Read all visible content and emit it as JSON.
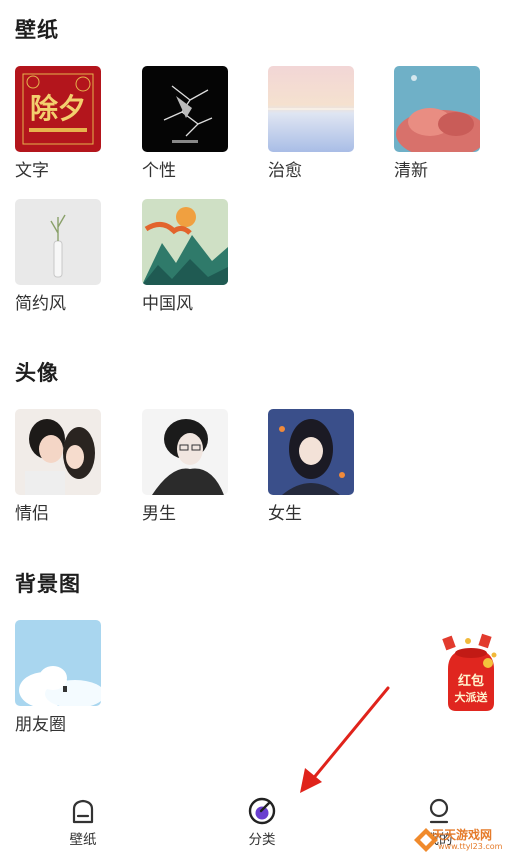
{
  "sections": {
    "wallpaper": {
      "title": "壁纸"
    },
    "avatar": {
      "title": "头像"
    },
    "background": {
      "title": "背景图"
    }
  },
  "wallpaper_items": [
    {
      "label": "文字",
      "thumb_text": "除夕"
    },
    {
      "label": "个性"
    },
    {
      "label": "治愈"
    },
    {
      "label": "清新"
    },
    {
      "label": "简约风"
    },
    {
      "label": "中国风"
    }
  ],
  "avatar_items": [
    {
      "label": "情侣"
    },
    {
      "label": "男生"
    },
    {
      "label": "女生"
    }
  ],
  "background_items": [
    {
      "label": "朋友圈"
    }
  ],
  "promo": {
    "line1": "红包",
    "line2": "大派送"
  },
  "tabbar": {
    "tabs": [
      {
        "label": "壁纸",
        "icon": "home-icon"
      },
      {
        "label": "分类",
        "icon": "category-icon",
        "active": true
      },
      {
        "label": "我的",
        "icon": "profile-icon"
      }
    ]
  },
  "watermark": {
    "text": "天天游戏网",
    "url": "www.ttyl23.com"
  },
  "colors": {
    "accent_red": "#d8281f",
    "active_purple": "#6a3fd0",
    "text_dark": "#1e1e1e"
  }
}
